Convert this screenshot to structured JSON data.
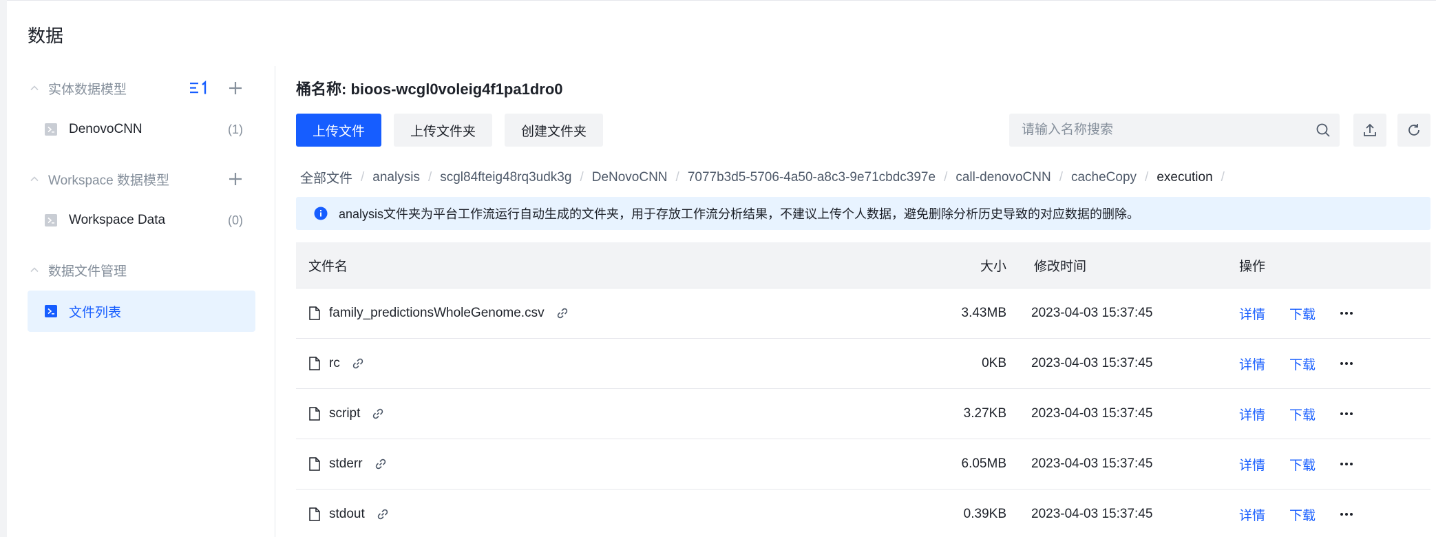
{
  "page": {
    "title": "数据"
  },
  "sidebar": {
    "sections": [
      {
        "label": "实体数据模型",
        "items": [
          {
            "label": "DenovoCNN",
            "count": "(1)"
          }
        ]
      },
      {
        "label": "Workspace 数据模型",
        "items": [
          {
            "label": "Workspace Data",
            "count": "(0)"
          }
        ]
      },
      {
        "label": "数据文件管理",
        "items": [
          {
            "label": "文件列表"
          }
        ]
      }
    ]
  },
  "main": {
    "bucket_title": "桶名称: bioos-wcgl0voleig4f1pa1dro0",
    "toolbar": {
      "upload_file": "上传文件",
      "upload_folder": "上传文件夹",
      "create_folder": "创建文件夹"
    },
    "search": {
      "placeholder": "请输入名称搜索",
      "value": ""
    },
    "breadcrumb": [
      "全部文件",
      "analysis",
      "scgl84fteig48rq3udk3g",
      "DeNovoCNN",
      "7077b3d5-5706-4a50-a8c3-9e71cbdc397e",
      "call-denovoCNN",
      "cacheCopy",
      "execution"
    ],
    "alert": "analysis文件夹为平台工作流运行自动生成的文件夹，用于存放工作流分析结果，不建议上传个人数据，避免删除分析历史导致的对应数据的删除。",
    "table": {
      "columns": {
        "name": "文件名",
        "size": "大小",
        "modified": "修改时间",
        "ops": "操作"
      },
      "rows": [
        {
          "name": "family_predictionsWholeGenome.csv",
          "size": "3.43MB",
          "modified": "2023-04-03 15:37:45"
        },
        {
          "name": "rc",
          "size": "0KB",
          "modified": "2023-04-03 15:37:45"
        },
        {
          "name": "script",
          "size": "3.27KB",
          "modified": "2023-04-03 15:37:45"
        },
        {
          "name": "stderr",
          "size": "6.05MB",
          "modified": "2023-04-03 15:37:45"
        },
        {
          "name": "stdout",
          "size": "0.39KB",
          "modified": "2023-04-03 15:37:45"
        }
      ],
      "actions": {
        "detail": "详情",
        "download": "下载"
      }
    }
  },
  "colors": {
    "primary": "#165dff",
    "muted": "#86909c",
    "bg_gray": "#f2f3f5",
    "alert_bg": "#e8f3ff"
  }
}
